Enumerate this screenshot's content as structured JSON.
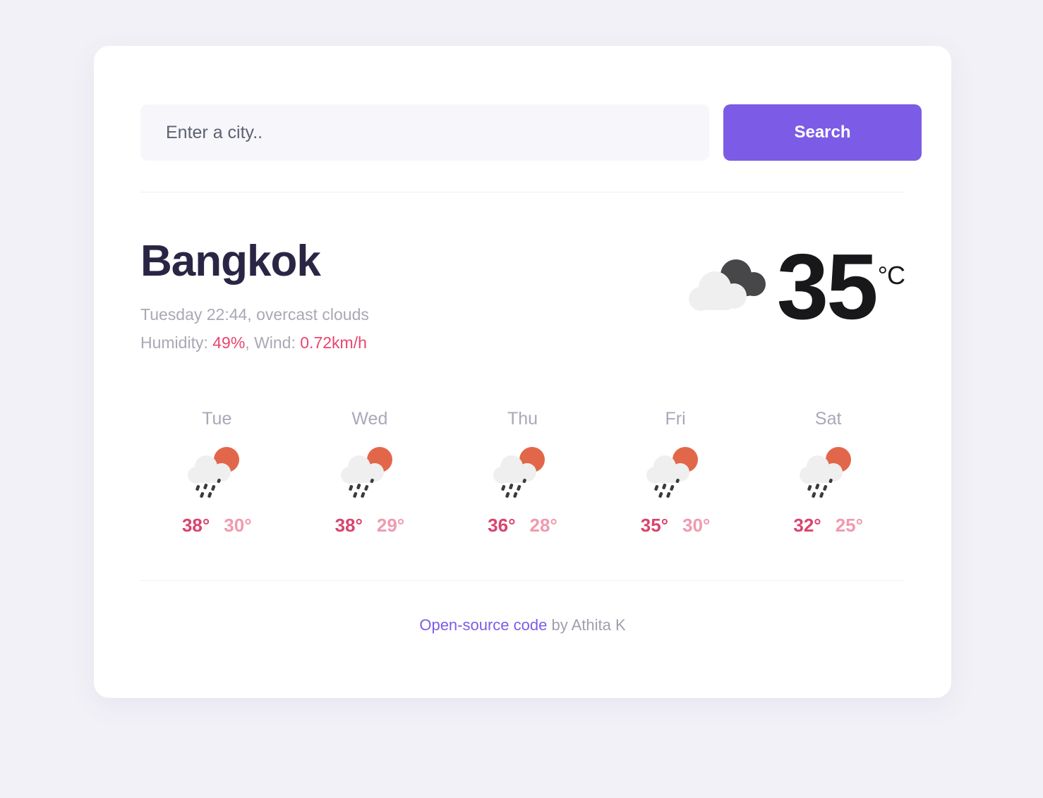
{
  "search": {
    "placeholder": "Enter a city..",
    "value": "",
    "button_label": "Search"
  },
  "current": {
    "city": "Bangkok",
    "datetime_description": "Tuesday 22:44, overcast clouds",
    "humidity_label": "Humidity: ",
    "humidity_value": "49%",
    "wind_separator": ", Wind: ",
    "wind_value": "0.72km/h",
    "temperature": "35",
    "unit": "°C",
    "icon": "overcast-clouds-icon"
  },
  "forecast": [
    {
      "day": "Tue",
      "icon": "rain-sun-icon",
      "max": "38°",
      "min": "30°"
    },
    {
      "day": "Wed",
      "icon": "rain-sun-icon",
      "max": "38°",
      "min": "29°"
    },
    {
      "day": "Thu",
      "icon": "rain-sun-icon",
      "max": "36°",
      "min": "28°"
    },
    {
      "day": "Fri",
      "icon": "rain-sun-icon",
      "max": "35°",
      "min": "30°"
    },
    {
      "day": "Sat",
      "icon": "rain-sun-icon",
      "max": "32°",
      "min": "25°"
    }
  ],
  "footer": {
    "link_label": "Open-source code",
    "suffix": " by Athita K"
  },
  "colors": {
    "accent": "#7c5ce6",
    "highlight": "#e8456f",
    "temp_max": "#d9446e",
    "temp_min": "#f09aaf",
    "heading": "#2b2545",
    "muted": "#a8a9b4",
    "page_bg": "#f2f1f7",
    "card_bg": "#ffffff",
    "input_bg": "#f7f6fb",
    "sun": "#e2674a",
    "cloud_light": "#efefef",
    "cloud_dark": "#474749"
  }
}
